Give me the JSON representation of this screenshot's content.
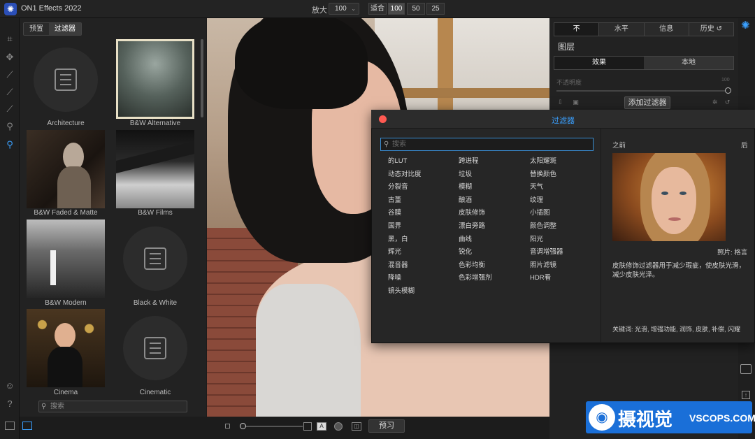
{
  "app": {
    "title": "ON1 Effects 2022",
    "logo_icon": "gear-flower-icon"
  },
  "toolbar": {
    "zoom_label": "放大",
    "zoom_value": "100",
    "fit_label": "适合",
    "zoom_presets": [
      "100",
      "50",
      "25"
    ]
  },
  "browser": {
    "tabs": [
      "预置",
      "过滤器"
    ],
    "active_tab": "过滤器",
    "items": [
      {
        "label": "Architecture",
        "type": "placeholder"
      },
      {
        "label": "B&W Alternative",
        "type": "photo",
        "selected": true
      },
      {
        "label": "B&W Faded & Matte",
        "type": "photo"
      },
      {
        "label": "B&W Films",
        "type": "photo"
      },
      {
        "label": "B&W Modern",
        "type": "photo"
      },
      {
        "label": "Black & White",
        "type": "placeholder"
      },
      {
        "label": "Cinema",
        "type": "photo"
      },
      {
        "label": "Cinematic",
        "type": "placeholder"
      }
    ],
    "search_placeholder": "搜索"
  },
  "right_panel": {
    "tabs": [
      "不",
      "水平",
      "信息",
      "历史"
    ],
    "layers_title": "图层",
    "sub_tabs": [
      "效果",
      "本地"
    ],
    "opacity_label": "不透明度",
    "opacity_value": "100",
    "add_filter_label": "添加过滤器"
  },
  "preview_bar": {
    "preview_label": "预习"
  },
  "filter_dialog": {
    "title": "过滤器",
    "search_placeholder": "搜索",
    "columns": [
      [
        "的LUT",
        "动态对比度",
        "分裂音",
        "古董",
        "谷膜",
        "国界",
        "黑，白",
        "辉光",
        "混音器",
        "降噪",
        "镜头模糊"
      ],
      [
        "跨进程",
        "垃圾",
        "模糊",
        "酿酒",
        "皮肤修饰",
        "漂白旁路",
        "曲线",
        "锐化",
        "色彩均衡",
        "色彩增强剂"
      ],
      [
        "太阳耀斑",
        "替换颜色",
        "天气",
        "纹理",
        "小插图",
        "颜色调整",
        "阳光",
        "音调增强器",
        "照片滤镜",
        "HDR看"
      ]
    ],
    "before_label": "之前",
    "after_label": "后",
    "photo_credit": "照片: 格言",
    "description": "皮肤修饰过滤器用于减少瑕疵，使皮肤光滑，减少皮肤光泽。",
    "keywords": "关键词: 光滑, 增强功能, 润饰, 皮肤, 补偿, 闪耀"
  },
  "watermark": {
    "cn": "摄视觉",
    "en": "VSCOPS.COM"
  },
  "colors": {
    "accent": "#3aa0ff",
    "close": "#ff5a52",
    "watermark": "#1a6fd8"
  }
}
